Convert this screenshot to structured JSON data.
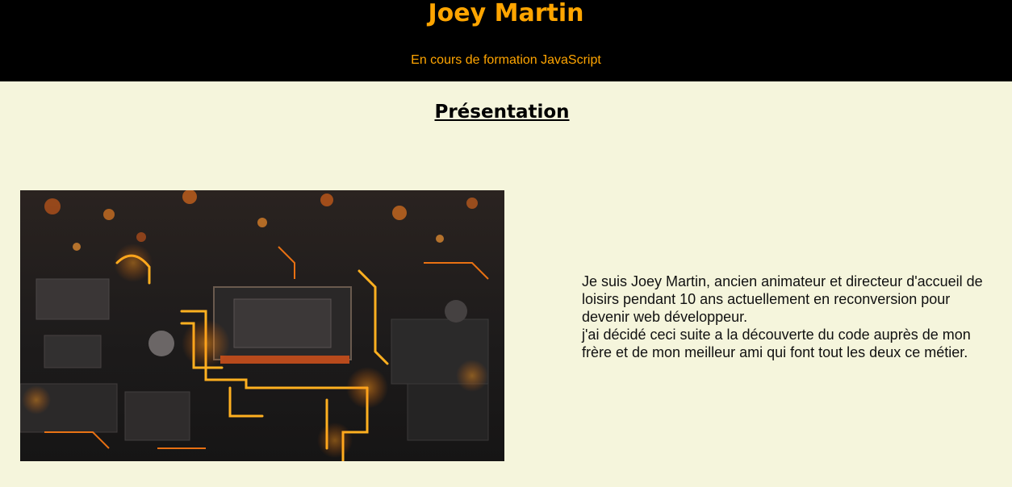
{
  "header": {
    "title": "Joey Martin",
    "subtitle": "En cours de formation JavaScript"
  },
  "main": {
    "section_title": "Présentation",
    "image_icon": "circuit-board-image",
    "paragraph_1": "Je suis Joey Martin, ancien animateur et directeur d'accueil de loisirs pendant 10 ans actuellement en reconversion pour devenir web développeur.",
    "paragraph_2": "j'ai décidé ceci suite a la découverte du code auprès de mon frère et de mon meilleur ami qui font tout les deux ce métier."
  },
  "colors": {
    "header_bg": "#000000",
    "accent": "#ffa500",
    "page_bg": "#f5f5dc",
    "text": "#111111"
  }
}
